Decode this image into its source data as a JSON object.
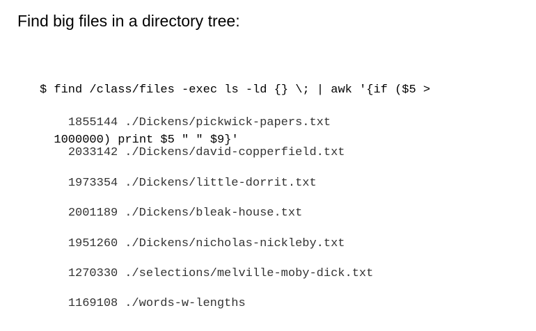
{
  "slide": {
    "heading": "Find big files in a directory tree:",
    "command_lines": [
      "$ find /class/files -exec ls -ld {} \\; | awk '{if ($5 >",
      "  1000000) print $5 \" \" $9}'"
    ],
    "output": [
      {
        "size": "1855144",
        "path": "./Dickens/pickwick-papers.txt"
      },
      {
        "size": "2033142",
        "path": "./Dickens/david-copperfield.txt"
      },
      {
        "size": "1973354",
        "path": "./Dickens/little-dorrit.txt"
      },
      {
        "size": "2001189",
        "path": "./Dickens/bleak-house.txt"
      },
      {
        "size": "1951260",
        "path": "./Dickens/nicholas-nickleby.txt"
      },
      {
        "size": "1270330",
        "path": "./selections/melville-moby-dick.txt"
      },
      {
        "size": "1169108",
        "path": "./words-w-lengths"
      }
    ]
  }
}
